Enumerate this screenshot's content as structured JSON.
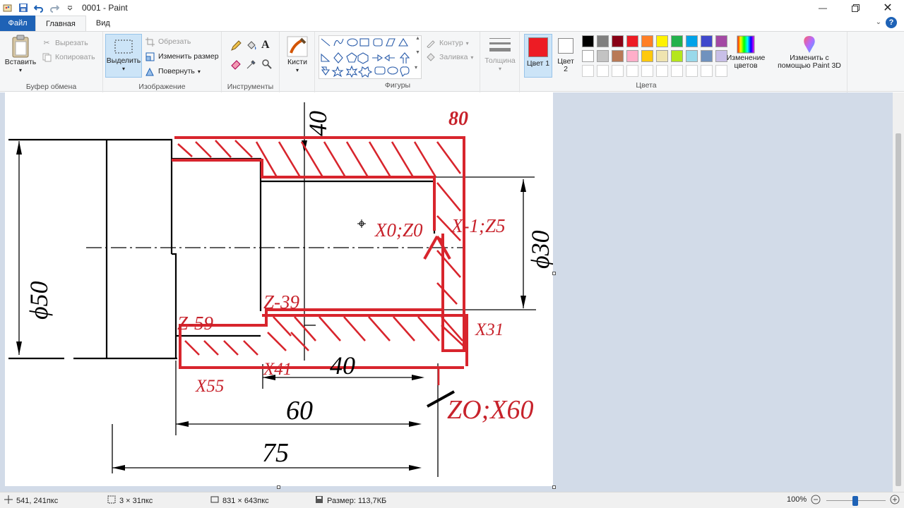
{
  "window": {
    "title": "0001 - Paint"
  },
  "tabs": {
    "file": "Файл",
    "home": "Главная",
    "view": "Вид"
  },
  "ribbon": {
    "clipboard": {
      "paste": "Вставить",
      "cut": "Вырезать",
      "copy": "Копировать",
      "label": "Буфер обмена"
    },
    "image": {
      "select": "Выделить",
      "crop": "Обрезать",
      "resize": "Изменить размер",
      "rotate": "Повернуть",
      "label": "Изображение"
    },
    "tools": {
      "label": "Инструменты"
    },
    "brushes": {
      "label": "Кисти"
    },
    "shapes": {
      "outline": "Контур",
      "fill": "Заливка",
      "label": "Фигуры"
    },
    "size": {
      "label": "Толщина"
    },
    "colors": {
      "color1": "Цвет 1",
      "color2": "Цвет 2",
      "edit": "Изменение цветов",
      "paint3d": "Изменить с помощью Paint 3D",
      "label": "Цвета",
      "color1_value": "#ed1c24",
      "color2_value": "#ffffff",
      "palette_row1": [
        "#000000",
        "#7f7f7f",
        "#880015",
        "#ed1c24",
        "#ff7f27",
        "#fff200",
        "#22b14c",
        "#00a2e8",
        "#3f48cc",
        "#a349a4"
      ],
      "palette_row2": [
        "#ffffff",
        "#c3c3c3",
        "#b97a57",
        "#ffaec9",
        "#ffc90e",
        "#efe4b0",
        "#b5e61d",
        "#99d9ea",
        "#7092be",
        "#c8bfe7"
      ]
    }
  },
  "drawing": {
    "dims": {
      "d40_top": "40",
      "d80": "80",
      "phi30": "ϕ30",
      "phi50": "ϕ50",
      "d40_bottom": "40",
      "d60": "60",
      "d75": "75"
    },
    "annotations": {
      "x0z0": "X0;Z0",
      "xm1z5": "X-1;Z5",
      "zm39": "Z-39",
      "zm59": "Z-59",
      "x31": "X31",
      "x41": "X41",
      "x55": "X55",
      "z0x60": "ZO;X60"
    }
  },
  "status": {
    "cursor": "541, 241пкс",
    "selection": "3 × 31пкс",
    "image_size": "831 × 643пкс",
    "file_size": "Размер: 113,7КБ",
    "zoom": "100%"
  }
}
